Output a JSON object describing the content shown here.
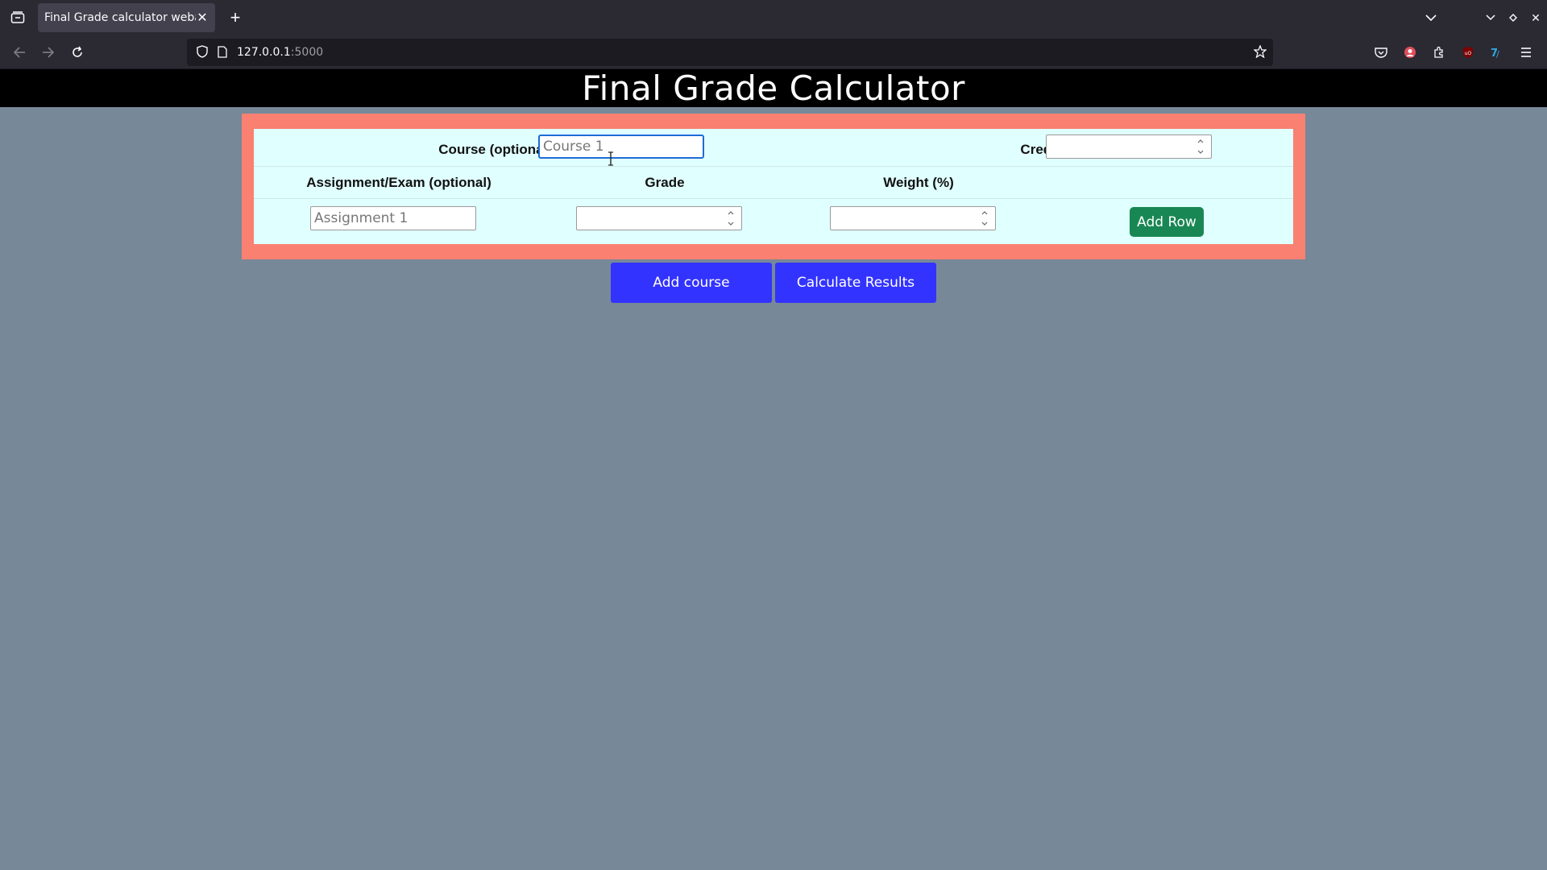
{
  "browser": {
    "tab_title": "Final Grade calculator webapp",
    "url_host": "127.0.0.1",
    "url_port": ":5000"
  },
  "page": {
    "title": "Final Grade Calculator"
  },
  "course": {
    "course_label": "Course (optional)",
    "course_placeholder": "Course 1",
    "credits_label": "Credits",
    "columns": [
      "Assignment/Exam (optional)",
      "Grade",
      "Weight (%)"
    ],
    "assignment_placeholder": "Assignment 1",
    "add_row_label": "Add Row"
  },
  "actions": {
    "add_course_label": "Add course",
    "calculate_label": "Calculate Results"
  }
}
